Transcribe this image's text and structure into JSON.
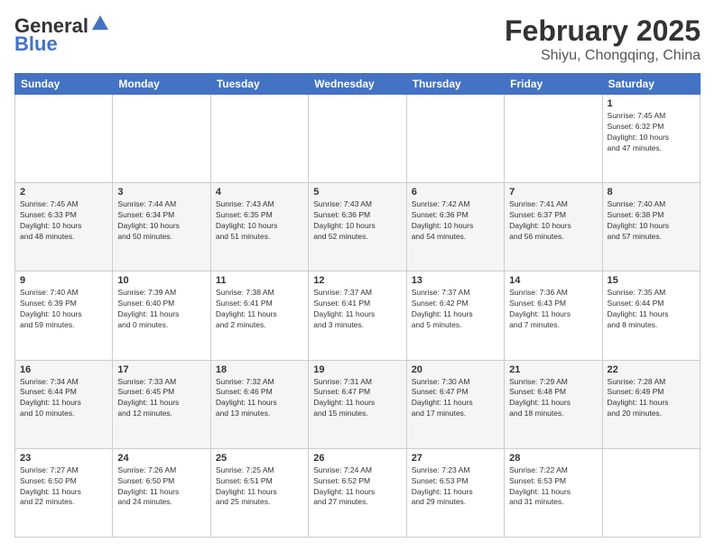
{
  "header": {
    "logo_line1": "General",
    "logo_line2": "Blue",
    "title": "February 2025",
    "subtitle": "Shiyu, Chongqing, China"
  },
  "days_of_week": [
    "Sunday",
    "Monday",
    "Tuesday",
    "Wednesday",
    "Thursday",
    "Friday",
    "Saturday"
  ],
  "weeks": [
    [
      {
        "day": "",
        "info": ""
      },
      {
        "day": "",
        "info": ""
      },
      {
        "day": "",
        "info": ""
      },
      {
        "day": "",
        "info": ""
      },
      {
        "day": "",
        "info": ""
      },
      {
        "day": "",
        "info": ""
      },
      {
        "day": "1",
        "info": "Sunrise: 7:45 AM\nSunset: 6:32 PM\nDaylight: 10 hours\nand 47 minutes."
      }
    ],
    [
      {
        "day": "2",
        "info": "Sunrise: 7:45 AM\nSunset: 6:33 PM\nDaylight: 10 hours\nand 48 minutes."
      },
      {
        "day": "3",
        "info": "Sunrise: 7:44 AM\nSunset: 6:34 PM\nDaylight: 10 hours\nand 50 minutes."
      },
      {
        "day": "4",
        "info": "Sunrise: 7:43 AM\nSunset: 6:35 PM\nDaylight: 10 hours\nand 51 minutes."
      },
      {
        "day": "5",
        "info": "Sunrise: 7:43 AM\nSunset: 6:36 PM\nDaylight: 10 hours\nand 52 minutes."
      },
      {
        "day": "6",
        "info": "Sunrise: 7:42 AM\nSunset: 6:36 PM\nDaylight: 10 hours\nand 54 minutes."
      },
      {
        "day": "7",
        "info": "Sunrise: 7:41 AM\nSunset: 6:37 PM\nDaylight: 10 hours\nand 56 minutes."
      },
      {
        "day": "8",
        "info": "Sunrise: 7:40 AM\nSunset: 6:38 PM\nDaylight: 10 hours\nand 57 minutes."
      }
    ],
    [
      {
        "day": "9",
        "info": "Sunrise: 7:40 AM\nSunset: 6:39 PM\nDaylight: 10 hours\nand 59 minutes."
      },
      {
        "day": "10",
        "info": "Sunrise: 7:39 AM\nSunset: 6:40 PM\nDaylight: 11 hours\nand 0 minutes."
      },
      {
        "day": "11",
        "info": "Sunrise: 7:38 AM\nSunset: 6:41 PM\nDaylight: 11 hours\nand 2 minutes."
      },
      {
        "day": "12",
        "info": "Sunrise: 7:37 AM\nSunset: 6:41 PM\nDaylight: 11 hours\nand 3 minutes."
      },
      {
        "day": "13",
        "info": "Sunrise: 7:37 AM\nSunset: 6:42 PM\nDaylight: 11 hours\nand 5 minutes."
      },
      {
        "day": "14",
        "info": "Sunrise: 7:36 AM\nSunset: 6:43 PM\nDaylight: 11 hours\nand 7 minutes."
      },
      {
        "day": "15",
        "info": "Sunrise: 7:35 AM\nSunset: 6:44 PM\nDaylight: 11 hours\nand 8 minutes."
      }
    ],
    [
      {
        "day": "16",
        "info": "Sunrise: 7:34 AM\nSunset: 6:44 PM\nDaylight: 11 hours\nand 10 minutes."
      },
      {
        "day": "17",
        "info": "Sunrise: 7:33 AM\nSunset: 6:45 PM\nDaylight: 11 hours\nand 12 minutes."
      },
      {
        "day": "18",
        "info": "Sunrise: 7:32 AM\nSunset: 6:46 PM\nDaylight: 11 hours\nand 13 minutes."
      },
      {
        "day": "19",
        "info": "Sunrise: 7:31 AM\nSunset: 6:47 PM\nDaylight: 11 hours\nand 15 minutes."
      },
      {
        "day": "20",
        "info": "Sunrise: 7:30 AM\nSunset: 6:47 PM\nDaylight: 11 hours\nand 17 minutes."
      },
      {
        "day": "21",
        "info": "Sunrise: 7:29 AM\nSunset: 6:48 PM\nDaylight: 11 hours\nand 18 minutes."
      },
      {
        "day": "22",
        "info": "Sunrise: 7:28 AM\nSunset: 6:49 PM\nDaylight: 11 hours\nand 20 minutes."
      }
    ],
    [
      {
        "day": "23",
        "info": "Sunrise: 7:27 AM\nSunset: 6:50 PM\nDaylight: 11 hours\nand 22 minutes."
      },
      {
        "day": "24",
        "info": "Sunrise: 7:26 AM\nSunset: 6:50 PM\nDaylight: 11 hours\nand 24 minutes."
      },
      {
        "day": "25",
        "info": "Sunrise: 7:25 AM\nSunset: 6:51 PM\nDaylight: 11 hours\nand 25 minutes."
      },
      {
        "day": "26",
        "info": "Sunrise: 7:24 AM\nSunset: 6:52 PM\nDaylight: 11 hours\nand 27 minutes."
      },
      {
        "day": "27",
        "info": "Sunrise: 7:23 AM\nSunset: 6:53 PM\nDaylight: 11 hours\nand 29 minutes."
      },
      {
        "day": "28",
        "info": "Sunrise: 7:22 AM\nSunset: 6:53 PM\nDaylight: 11 hours\nand 31 minutes."
      },
      {
        "day": "",
        "info": ""
      }
    ]
  ]
}
